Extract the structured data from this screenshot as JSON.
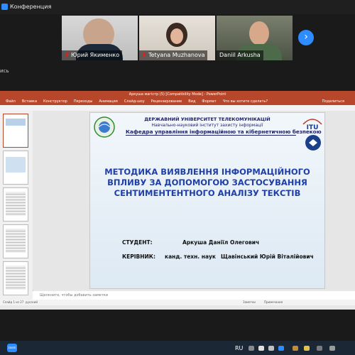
{
  "window": {
    "title": "Конференция"
  },
  "participants": [
    {
      "name": "Юрий Якименко"
    },
    {
      "name": "Tetyana Muzhanova"
    },
    {
      "name": "Daniil Arkusha"
    }
  ],
  "nav": {
    "next_icon": "›"
  },
  "left_label": "ись",
  "ppt": {
    "title": "Аркуша магістр (5) [Compatibility Mode] - PowerPoint",
    "tabs": [
      "Файл",
      "Вставка",
      "Конструктор",
      "Переходы",
      "Анимация",
      "Слайд-шоу",
      "Рецензирование",
      "Вид",
      "Формат",
      "Что вы хотите сделать?"
    ],
    "share": "Поделиться",
    "notes_placeholder": "Щелкните, чтобы добавить заметки",
    "status": {
      "slide": "Слайд 1 из 27",
      "language": "русский",
      "notes_btn": "Заметки",
      "comments_btn": "Примечания"
    }
  },
  "slide": {
    "university": "ДЕРЖАВНИЙ УНІВЕРСИТЕТ ТЕЛЕКОМУНІКАЦІЙ",
    "institute": "Навчально-науковий інститут захисту інформації",
    "department": "Кафедра управління інформаційною та кібернетичною безпекою",
    "title_lines": [
      "МЕТОДИКА ВИЯВЛЕННЯ ІНФОРМАЦІЙНОГО",
      "ВПЛИВУ ЗА ДОПОМОГОЮ ЗАСТОСУВАННЯ",
      "СЕНТИМЕНТЕНТНОГО АНАЛІЗУ ТЕКСТІВ"
    ],
    "student_label": "СТУДЕНТ:",
    "student_name": "Аркуша Даніїл Олегович",
    "advisor_label": "КЕРІВНИК:",
    "advisor_degree": "канд. техн. наук",
    "advisor_name": "Щавінський Юрій Віталійович",
    "itu_logo": "ITU"
  },
  "taskbar": {
    "app_label": "zoom",
    "language": "RU"
  },
  "colors": {
    "zoom_blue": "#2d8cff",
    "ppt_red": "#b7472a",
    "title_blue": "#1f3fa8",
    "muted_mic": "#e02020"
  }
}
